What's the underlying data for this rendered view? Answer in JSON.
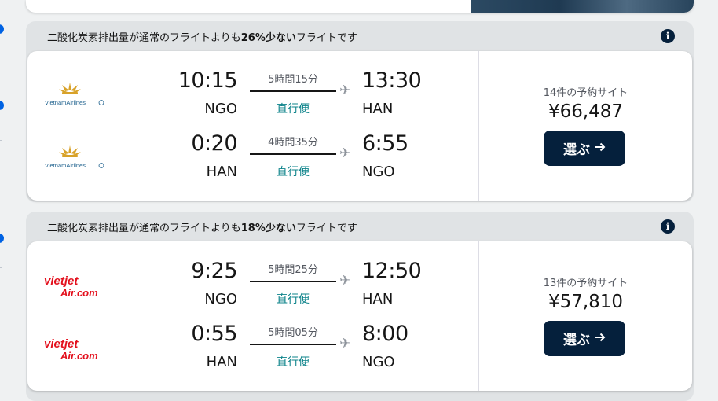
{
  "results": [
    {
      "eco_prefix": "二酸化炭素排出量が通常のフライトよりも",
      "eco_percent": "26%少ない",
      "eco_suffix": "フライトです",
      "booking_sites": "14件の予約サイト",
      "price": "¥66,487",
      "select_label": "選ぶ",
      "legs": [
        {
          "airline": "Vietnam Airlines",
          "dep_time": "10:15",
          "dep_airport": "NGO",
          "duration": "5時間15分",
          "stops": "直行便",
          "arr_time": "13:30",
          "arr_airport": "HAN"
        },
        {
          "airline": "Vietnam Airlines",
          "dep_time": "0:20",
          "dep_airport": "HAN",
          "duration": "4時間35分",
          "stops": "直行便",
          "arr_time": "6:55",
          "arr_airport": "NGO"
        }
      ]
    },
    {
      "eco_prefix": "二酸化炭素排出量が通常のフライトよりも",
      "eco_percent": "18%少ない",
      "eco_suffix": "フライトです",
      "booking_sites": "13件の予約サイト",
      "price": "¥57,810",
      "select_label": "選ぶ",
      "legs": [
        {
          "airline": "VietJet Air",
          "dep_time": "9:25",
          "dep_airport": "NGO",
          "duration": "5時間25分",
          "stops": "直行便",
          "arr_time": "12:50",
          "arr_airport": "HAN"
        },
        {
          "airline": "VietJet Air",
          "dep_time": "0:55",
          "dep_airport": "HAN",
          "duration": "5時間05分",
          "stops": "直行便",
          "arr_time": "8:00",
          "arr_airport": "NGO"
        }
      ]
    }
  ],
  "icons": {
    "info": "info-icon",
    "arrow": "arrow-right-icon",
    "plane": "plane-icon"
  },
  "colors": {
    "primary": "#05203c",
    "accent": "#0062e3",
    "direct": "#0c838a",
    "vietjet_red": "#e3101d",
    "vietnam_gold": "#d8a229"
  }
}
